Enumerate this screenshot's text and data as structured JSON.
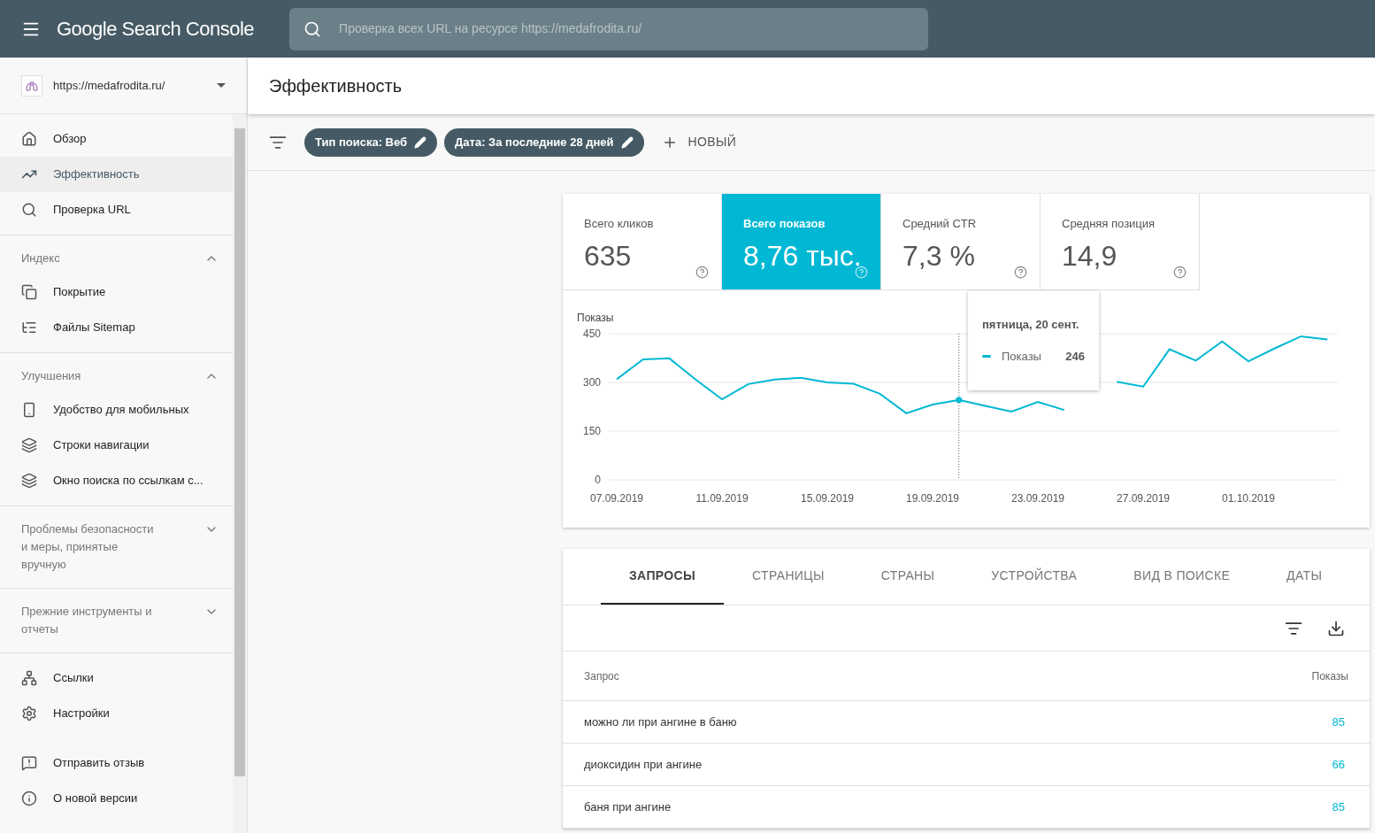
{
  "header": {
    "product": "Google Search Console",
    "search": {
      "placeholder": "Проверка всех URL на ресурсе https://medafrodita.ru/"
    }
  },
  "sidebar": {
    "property": "https://medafrodita.ru/",
    "sections": [
      {
        "items": [
          {
            "label": "Обзор",
            "selected": false
          },
          {
            "label": "Эффективность",
            "selected": true
          },
          {
            "label": "Проверка URL",
            "selected": false
          }
        ]
      },
      {
        "title": "Индекс",
        "expanded": true,
        "items": [
          {
            "label": "Покрытие",
            "selected": false
          },
          {
            "label": "Файлы Sitemap",
            "selected": false
          }
        ]
      },
      {
        "title": "Улучшения",
        "expanded": true,
        "items": [
          {
            "label": "Удобство для мобильных",
            "selected": false
          },
          {
            "label": "Строки навигации",
            "selected": false
          },
          {
            "label": "Окно поиска по ссылкам с...",
            "selected": false
          }
        ]
      },
      {
        "title": "Проблемы безопасности и меры, принятые вручную",
        "expanded": false
      },
      {
        "title": "Прежние инструменты и отчеты",
        "expanded": false
      },
      {
        "items": [
          {
            "label": "Ссылки",
            "selected": false
          },
          {
            "label": "Настройки",
            "selected": false
          }
        ]
      },
      {
        "items": [
          {
            "label": "Отправить отзыв",
            "selected": false
          },
          {
            "label": "О новой версии",
            "selected": false
          }
        ]
      }
    ]
  },
  "page_title": "Эффективность",
  "filters": {
    "chips": [
      "Тип поиска: Веб",
      "Дата: За последние 28 дней"
    ],
    "new_button": "НОВЫЙ"
  },
  "metrics": [
    {
      "label": "Всего кликов",
      "value": "635",
      "selected": false
    },
    {
      "label": "Всего показов",
      "value": "8,76 тыс.",
      "selected": true
    },
    {
      "label": "Средний CTR",
      "value": "7,3 %",
      "selected": false
    },
    {
      "label": "Средняя позиция",
      "value": "14,9",
      "selected": false
    }
  ],
  "chart": {
    "chart_data": {
      "type": "line",
      "ylabel": "Показы",
      "categories": [
        "07.09.2019",
        null,
        null,
        null,
        "11.09.2019",
        null,
        null,
        null,
        "15.09.2019",
        null,
        null,
        null,
        "19.09.2019",
        null,
        null,
        null,
        "23.09.2019",
        null,
        null,
        null,
        "27.09.2019",
        null,
        null,
        null,
        "01.10.2019",
        null,
        null,
        null
      ],
      "series": [
        {
          "name": "Показы",
          "color": "#00b8d4",
          "values": [
            310,
            371,
            374,
            309,
            248,
            295,
            309,
            314,
            300,
            296,
            265,
            205,
            232,
            246,
            228,
            210,
            240,
            215,
            null,
            302,
            287,
            402,
            367,
            426,
            365,
            405,
            442,
            432
          ]
        }
      ],
      "ylim": [
        0,
        450
      ],
      "yticks": [
        0,
        150,
        300,
        450
      ]
    },
    "tooltip": {
      "title": "пятница, 20 сент.",
      "value": "246"
    }
  },
  "tabs": [
    {
      "label": "ЗАПРОСЫ",
      "selected": true
    },
    {
      "label": "СТРАНИЦЫ",
      "selected": false
    },
    {
      "label": "СТРАНЫ",
      "selected": false
    },
    {
      "label": "УСТРОЙСТВА",
      "selected": false
    },
    {
      "label": "ВИД В ПОИСКЕ",
      "selected": false
    },
    {
      "label": "ДАТЫ",
      "selected": false
    }
  ],
  "table": {
    "columns": [
      "Запрос",
      "Показы"
    ],
    "rows": [
      {
        "query": "можно ли при ангине в баню",
        "impressions": "85"
      },
      {
        "query": "диоксидин при ангине",
        "impressions": "66"
      },
      {
        "query": "баня при ангине",
        "impressions": "85"
      }
    ]
  }
}
